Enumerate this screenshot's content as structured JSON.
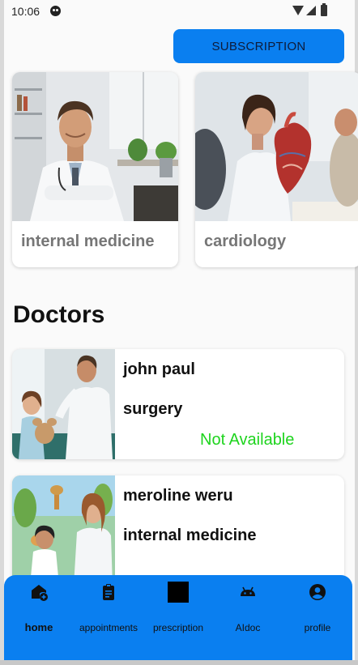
{
  "status_bar": {
    "time": "10:06"
  },
  "subscribe": {
    "label": "SUBSCRIPTION"
  },
  "categories": [
    {
      "label": "internal medicine"
    },
    {
      "label": "cardiology"
    }
  ],
  "doctors_section": {
    "title": "Doctors"
  },
  "doctors": [
    {
      "name": "john paul",
      "specialty": "surgery",
      "status": "Not Available"
    },
    {
      "name": "meroline weru",
      "specialty": "internal medicine"
    }
  ],
  "bottom_nav": {
    "items": [
      {
        "label": "home",
        "icon": "home-add-icon",
        "active": true
      },
      {
        "label": "appointments",
        "icon": "clipboard-icon"
      },
      {
        "label": "prescription",
        "icon": "black-square-icon"
      },
      {
        "label": "AIdoc",
        "icon": "android-icon"
      },
      {
        "label": "profile",
        "icon": "account-circle-icon"
      }
    ]
  },
  "colors": {
    "primary": "#0a7ff0",
    "available_status": "#1ed41e",
    "category_label": "#767676"
  }
}
